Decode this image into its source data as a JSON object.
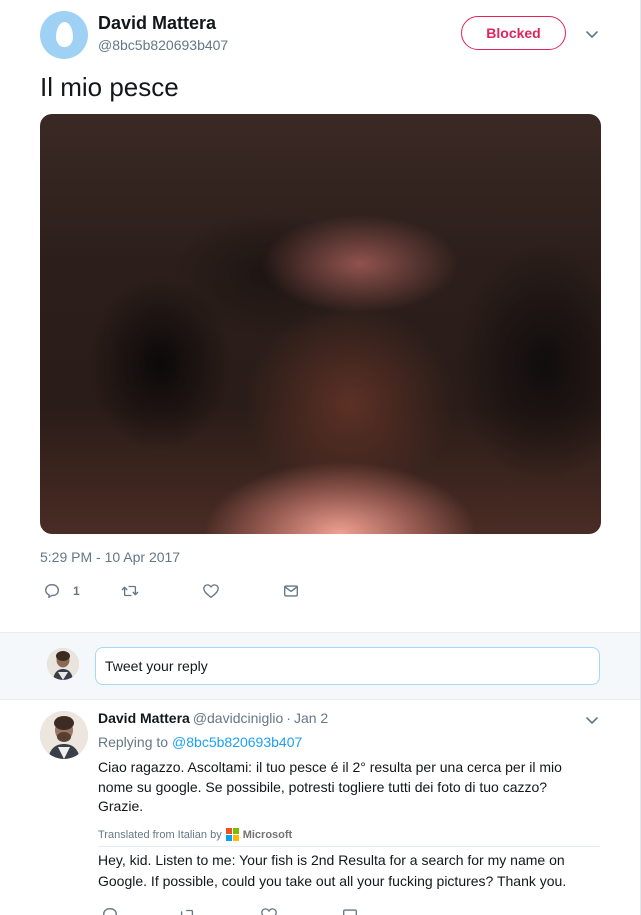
{
  "main_tweet": {
    "author_name": "David Mattera",
    "author_handle": "@8bc5b820693b407",
    "follow_state_label": "Blocked",
    "text": "Il mio pesce",
    "timestamp": "5:29 PM - 10 Apr 2017",
    "reply_count": "1",
    "icons": {
      "reply": "reply-icon",
      "retweet": "retweet-icon",
      "like": "heart-icon",
      "dm": "envelope-icon",
      "more": "chevron-down-icon"
    }
  },
  "reply_box": {
    "placeholder": "Tweet your reply"
  },
  "reply_tweet": {
    "author_name": "David Mattera",
    "author_handle": "@davidciniglio",
    "separator": "·",
    "time": "Jan 2",
    "replying_to_label": "Replying to",
    "replying_to_handle": "@8bc5b820693b407",
    "text": "Ciao ragazzo. Ascoltami: il tuo pesce é il 2° resulta per una cerca per il mio nome su google. Se possibile, potresti togliere tutti dei foto di tuo cazzo? Grazie.",
    "translated_from": "Translated from Italian by",
    "translator": "Microsoft",
    "translation": "Hey, kid. Listen to me: Your fish is 2nd Resulta for a search for my name on Google. If possible, could you take out all your fucking pictures? Thank you."
  },
  "colors": {
    "blocked": "#e0245e",
    "link": "#1da1f2",
    "secondary_text": "#657786",
    "microsoft_red": "#f25022",
    "microsoft_green": "#7fba00",
    "microsoft_blue": "#00a4ef",
    "microsoft_yellow": "#ffb900"
  }
}
